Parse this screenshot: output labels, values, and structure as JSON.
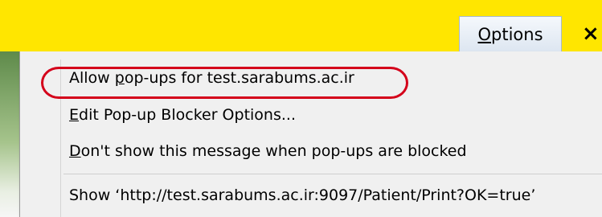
{
  "notification_bar": {
    "options_button": {
      "label": "Options",
      "access_key": "O",
      "rest": "ptions"
    },
    "close_icon": "×"
  },
  "menu": {
    "items": [
      {
        "access_key": "",
        "pre": "Allow ",
        "key": "p",
        "post": "op-ups for test.sarabums.ac.ir"
      },
      {
        "access_key": "E",
        "pre": "",
        "key": "E",
        "post": "dit Pop-up Blocker Options..."
      },
      {
        "access_key": "D",
        "pre": "",
        "key": "D",
        "post": "on't show this message when pop-ups are blocked"
      }
    ],
    "show_item": "Show ‘http://test.sarabums.ac.ir:9097/Patient/Print?OK=true’"
  },
  "colors": {
    "notification_bar": "#ffe600",
    "highlight_oval": "#d4001a"
  }
}
